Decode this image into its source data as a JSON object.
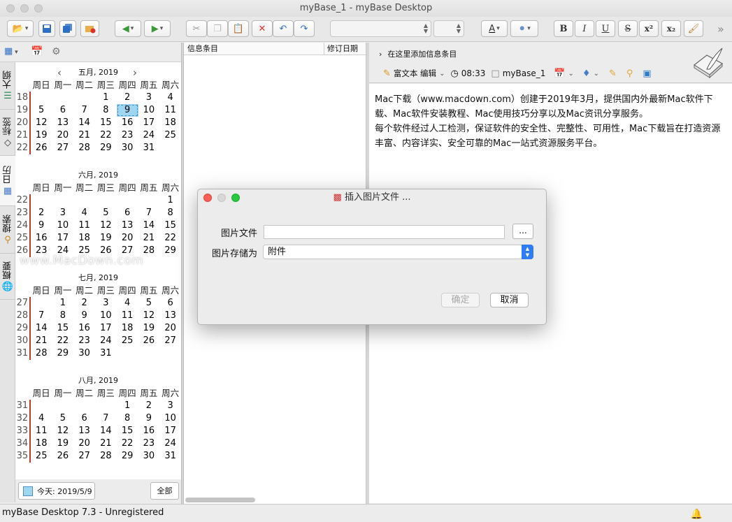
{
  "window": {
    "title": "myBase_1 - myBase Desktop"
  },
  "toolbar": {
    "buttons": [
      "folder-open-icon",
      "save-icon",
      "save-all-icon",
      "close-db-icon",
      "back-icon",
      "forward-icon",
      "cut-icon",
      "copy-icon",
      "paste-icon",
      "delete-icon",
      "undo-icon",
      "redo-icon",
      "font-color-icon",
      "highlight-icon",
      "bold",
      "italic",
      "underline",
      "strikethrough",
      "superscript",
      "subscript",
      "clear-format-icon",
      "overflow-icon"
    ],
    "bold": "B",
    "italic": "I",
    "underline": "U",
    "strike": "S",
    "superscript": "x²",
    "subscript": "x₂",
    "font_color_letter": "A",
    "overflow": "»"
  },
  "sidebar": {
    "tabs": [
      {
        "label": "大纲",
        "icon": "outline-icon"
      },
      {
        "label": "标签",
        "icon": "tag-icon"
      },
      {
        "label": "日历",
        "icon": "calendar-icon"
      },
      {
        "label": "搜索",
        "icon": "search-icon"
      },
      {
        "label": "概要",
        "icon": "globe-icon"
      }
    ]
  },
  "calendar": {
    "weekdays": [
      "周日",
      "周一",
      "周二",
      "周三",
      "周四",
      "周五",
      "周六"
    ],
    "selected": {
      "month": 0,
      "day": "9"
    },
    "months": [
      {
        "title": "五月, 2019",
        "weeks": [
          [
            "18",
            "",
            "",
            "",
            "1",
            "2",
            "3",
            "4"
          ],
          [
            "19",
            "5",
            "6",
            "7",
            "8",
            "9",
            "10",
            "11"
          ],
          [
            "20",
            "12",
            "13",
            "14",
            "15",
            "16",
            "17",
            "18"
          ],
          [
            "21",
            "19",
            "20",
            "21",
            "22",
            "23",
            "24",
            "25"
          ],
          [
            "22",
            "26",
            "27",
            "28",
            "29",
            "30",
            "31",
            ""
          ]
        ]
      },
      {
        "title": "六月, 2019",
        "weeks": [
          [
            "22",
            "",
            "",
            "",
            "",
            "",
            "",
            "1"
          ],
          [
            "23",
            "2",
            "3",
            "4",
            "5",
            "6",
            "7",
            "8"
          ],
          [
            "24",
            "9",
            "10",
            "11",
            "12",
            "13",
            "14",
            "15"
          ],
          [
            "25",
            "16",
            "17",
            "18",
            "19",
            "20",
            "21",
            "22"
          ],
          [
            "26",
            "23",
            "24",
            "25",
            "26",
            "27",
            "28",
            "29"
          ]
        ]
      },
      {
        "title": "七月, 2019",
        "weeks": [
          [
            "27",
            "",
            "1",
            "2",
            "3",
            "4",
            "5",
            "6"
          ],
          [
            "28",
            "7",
            "8",
            "9",
            "10",
            "11",
            "12",
            "13"
          ],
          [
            "29",
            "14",
            "15",
            "16",
            "17",
            "18",
            "19",
            "20"
          ],
          [
            "30",
            "21",
            "22",
            "23",
            "24",
            "25",
            "26",
            "27"
          ],
          [
            "31",
            "28",
            "29",
            "30",
            "31",
            "",
            "",
            ""
          ]
        ]
      },
      {
        "title": "八月, 2019",
        "weeks": [
          [
            "31",
            "",
            "",
            "",
            "",
            "1",
            "2",
            "3"
          ],
          [
            "32",
            "4",
            "5",
            "6",
            "7",
            "8",
            "9",
            "10"
          ],
          [
            "33",
            "11",
            "12",
            "13",
            "14",
            "15",
            "16",
            "17"
          ],
          [
            "34",
            "18",
            "19",
            "20",
            "21",
            "22",
            "23",
            "24"
          ],
          [
            "35",
            "25",
            "26",
            "27",
            "28",
            "29",
            "30",
            "31"
          ]
        ]
      }
    ],
    "today_label": "今天: 2019/5/9",
    "all_label": "全部"
  },
  "list": {
    "col_title": "信息条目",
    "col_date": "修订日期"
  },
  "editor": {
    "breadcrumb": "在这里添加信息条目",
    "mode_label": "富文本 编辑",
    "time": "08:33",
    "db_name": "myBase_1",
    "content": [
      "Mac下载（www.macdown.com）创建于2019年3月，提供国内外最新Mac软件下",
      "载、Mac软件安装教程、Mac使用技巧分享以及Mac资讯分享服务。",
      "每个软件经过人工检测，保证软件的安全性、完整性、可用性，Mac下载旨在打造资源",
      "丰富、内容详实、安全可靠的Mac一站式资源服务平台。"
    ]
  },
  "watermark": "www.MacDown.com",
  "dialog": {
    "title": "插入图片文件 ...",
    "file_label": "图片文件",
    "file_value": "",
    "browse_label": "...",
    "store_label": "图片存储为",
    "store_value": "附件",
    "ok_label": "确定",
    "cancel_label": "取消"
  },
  "status": {
    "text": "myBase Desktop 7.3 - Unregistered"
  }
}
